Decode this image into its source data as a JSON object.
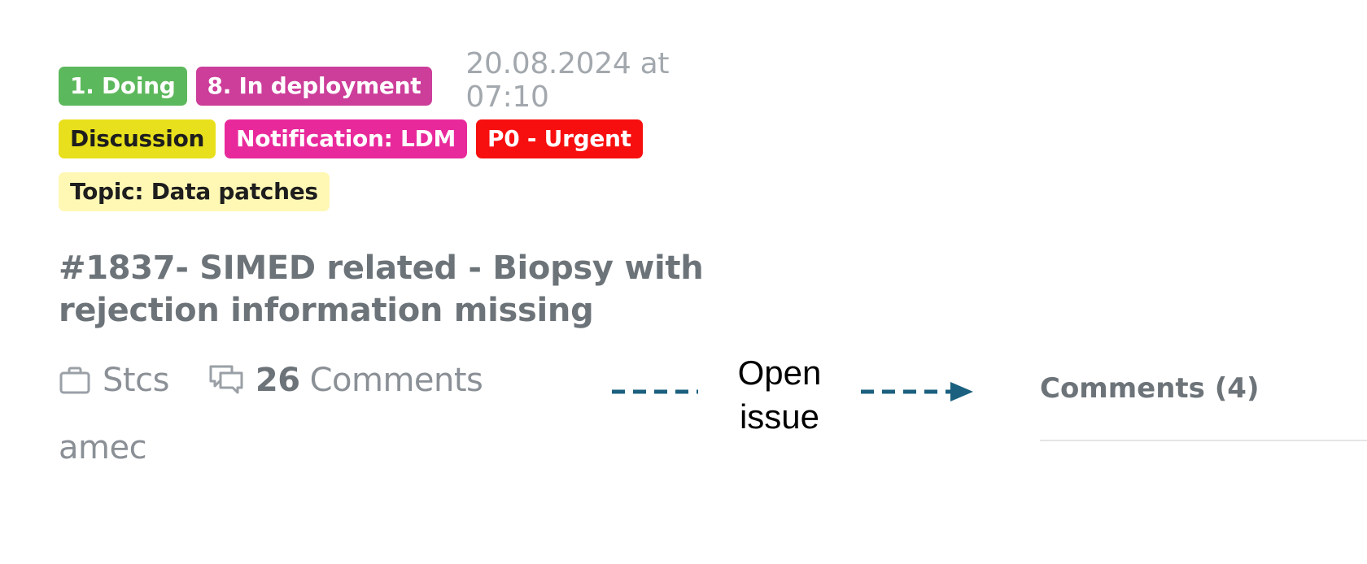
{
  "issue": {
    "labels_row1": [
      {
        "text": "1. Doing",
        "bg": "#5cb85c",
        "fg": "#ffffff"
      },
      {
        "text": "8. In deployment",
        "bg": "#cc3e9a",
        "fg": "#ffffff"
      }
    ],
    "timestamp": "20.08.2024 at 07:10",
    "labels_row2": [
      {
        "text": "Discussion",
        "bg": "#e8e01c",
        "fg": "#1e1e1e"
      },
      {
        "text": "Notification: LDM",
        "bg": "#e8299b",
        "fg": "#ffffff"
      },
      {
        "text": "P0 - Urgent",
        "bg": "#f70f0f",
        "fg": "#ffffff"
      }
    ],
    "labels_row3": [
      {
        "text": "Topic: Data patches",
        "bg": "#fff8b5",
        "fg": "#1e1e1e"
      }
    ],
    "title": "#1837- SIMED related - Biopsy with rejection information missing",
    "project": {
      "icon": "briefcase-icon",
      "label": "Stcs"
    },
    "comments": {
      "icon": "comments-icon",
      "count": "26",
      "label": "Comments"
    },
    "assignee": "amec"
  },
  "annotation": {
    "text_line1": "Open",
    "text_line2": "issue",
    "arrow_color": "#1b607f"
  },
  "detail": {
    "comments_tab": "Comments (4)"
  }
}
